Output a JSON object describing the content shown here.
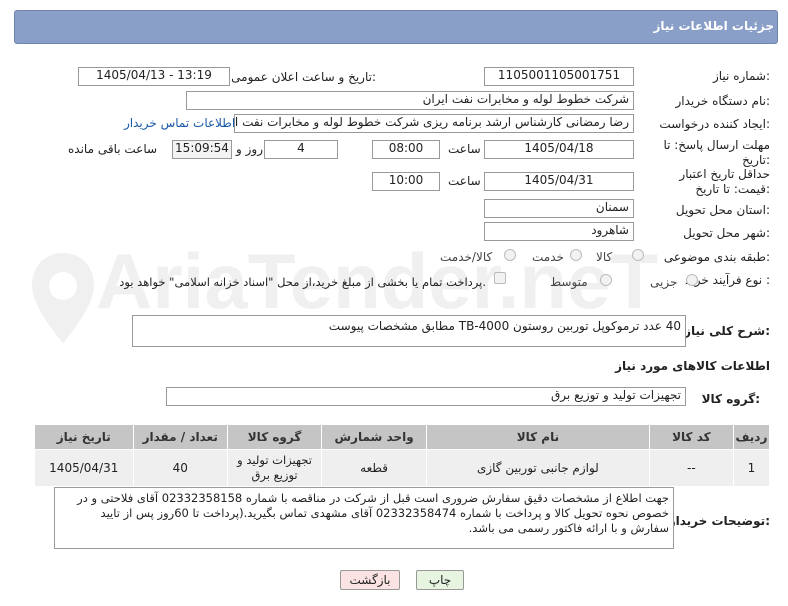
{
  "header": {
    "title": "جزئیات اطلاعات نیاز"
  },
  "fields": {
    "need_number_label": "شماره نیاز:",
    "need_number": "1105001105001751",
    "announce_label": "تاریخ و ساعت اعلان عمومی:",
    "announce_value": "1405/04/13 - 13:19",
    "buyer_org_label": "نام دستگاه خریدار:",
    "buyer_org": "شرکت خطوط لوله و مخابرات نفت ایران",
    "creator_label": "ایجاد کننده درخواست:",
    "creator": "رضا رمضانی کارشناس ارشد برنامه ریزی  شرکت خطوط لوله و مخابرات نفت ایران",
    "buyer_contact_link": "اطلاعات تماس خریدار",
    "reply_deadline_label": "مهلت ارسال پاسخ: تا تاریخ:",
    "reply_date": "1405/04/18",
    "time_label": "ساعت",
    "reply_time": "08:00",
    "days_value": "4",
    "days_label": "روز و",
    "remaining_time": "15:09:54",
    "remaining_label": "ساعت باقی مانده",
    "price_deadline_label": "حداقل تاریخ اعتبار قیمت: تا تاریخ:",
    "price_date": "1405/04/31",
    "price_time": "10:00",
    "province_label": "استان محل تحویل:",
    "province": "سمنان",
    "city_label": "شهر محل تحویل:",
    "city": "شاهرود",
    "category_label": "طبقه بندی موضوعی:",
    "category_options": [
      "کالا",
      "خدمت",
      "کالا/خدمت"
    ],
    "process_label": "نوع فرآیند خرید :",
    "process_options": [
      "جزیی",
      "متوسط"
    ],
    "payment_note": "پرداخت تمام یا بخشی از مبلغ خرید،از محل \"اسناد خزانه اسلامی\" خواهد بود.",
    "description_label": "شرح کلی نیاز:",
    "description": "40 عدد ترموکوپل توربین روستون  TB-4000 مطابق مشخصات پیوست",
    "goods_info_title": "اطلاعات کالاهای مورد نیاز",
    "goods_group_label": "گروه کالا:",
    "goods_group": "تجهیزات تولید و توزیع برق",
    "buyer_notes_label": "توضیحات خریدار:",
    "buyer_notes": "جهت اطلاع از مشخصات دقیق سفارش ضروری است قبل از شرکت در مناقصه با شماره 02332358158 آقای فلاحتی و در خصوص نحوه تحویل کالا و پرداخت با شماره  02332358474 آقای مشهدی تماس بگیرید.(پرداخت تا  60روز پس از تایید سفارش و با ارائه فاکتور رسمی می باشد."
  },
  "table": {
    "headers": [
      "ردیف",
      "کد کالا",
      "نام کالا",
      "واحد شمارش",
      "گروه کالا",
      "تعداد / مقدار",
      "تاریخ نیاز"
    ],
    "rows": [
      [
        "1",
        "--",
        "لوازم جانبی توربین گازی",
        "قطعه",
        "تجهیزات تولید و توزیع برق",
        "40",
        "1405/04/31"
      ]
    ]
  },
  "buttons": {
    "print": "چاپ",
    "back": "بازگشت"
  },
  "watermark": "AriaTender.neT",
  "colors": {
    "header_bg": "#8a9fc7",
    "print_btn": "#e6f4e0",
    "back_btn": "#fbe3e3",
    "link": "#1a5aa8"
  }
}
